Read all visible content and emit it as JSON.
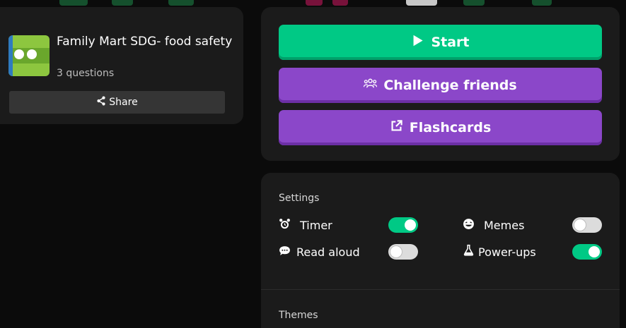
{
  "quiz": {
    "title": "Family Mart SDG- food safety",
    "question_count": "3 questions",
    "share_label": "Share"
  },
  "actions": {
    "start_label": "Start",
    "challenge_label": "Challenge friends",
    "flashcards_label": "Flashcards"
  },
  "settings": {
    "section_label": "Settings",
    "items": [
      {
        "label": "Timer",
        "icon": "alarm-clock-icon",
        "on": true
      },
      {
        "label": "Memes",
        "icon": "laughing-face-icon",
        "on": false
      },
      {
        "label": "Read aloud",
        "icon": "speech-bubble-icon",
        "on": false
      },
      {
        "label": "Power-ups",
        "icon": "flask-icon",
        "on": true
      }
    ]
  },
  "themes": {
    "section_label": "Themes"
  },
  "colors": {
    "start": "#00c985",
    "purple": "#8b47c9",
    "toggle_on": "#00c985",
    "toggle_off": "#dcdcdc",
    "card": "#1b1b1b",
    "background": "#0b0b0b"
  }
}
